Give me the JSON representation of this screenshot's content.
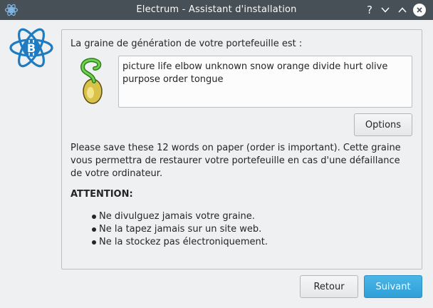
{
  "window": {
    "title": "Electrum  -  Assistant d'installation",
    "help_label": "?"
  },
  "content": {
    "seed_title": "La graine de génération de votre portefeuille est :",
    "seed_text": "picture life elbow unknown snow orange divide hurt olive purpose order tongue",
    "options_label": "Options",
    "info_text": "Please save these 12 words on paper (order is important). Cette graine vous permettra de restaurer votre portefeuille en cas d'une défaillance de votre ordinateur.",
    "attention_label": "ATTENTION:",
    "warnings": [
      "Ne divulguez jamais votre graine.",
      "Ne la tapez jamais sur un site web.",
      "Ne la stockez pas électroniquement."
    ]
  },
  "footer": {
    "back_label": "Retour",
    "next_label": "Suivant"
  },
  "icons": {
    "app": "electrum-icon",
    "logo": "bitcoin-atom-logo",
    "seed": "sprouting-seed-icon"
  },
  "colors": {
    "titlebar": "#475057",
    "window_bg": "#eff0f1",
    "accent": "#3daee9",
    "seed_green": "#4caf50",
    "logo_blue": "#1f7bc2"
  }
}
